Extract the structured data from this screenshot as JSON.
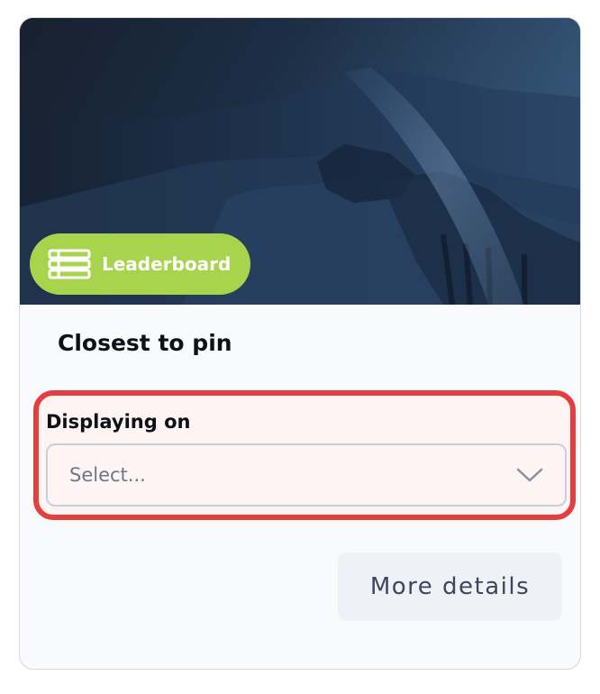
{
  "card": {
    "badge": {
      "label": "Leaderboard",
      "icon": "leaderboard-list-icon",
      "color": "#a7d44c"
    },
    "title": "Closest to pin",
    "display_field": {
      "label": "Displaying on",
      "placeholder": "Select...",
      "icon": "chevron-down-icon"
    },
    "more_details_label": "More details"
  },
  "colors": {
    "highlight_border": "#e53e3e",
    "hero_background": "#1b2a3d"
  }
}
